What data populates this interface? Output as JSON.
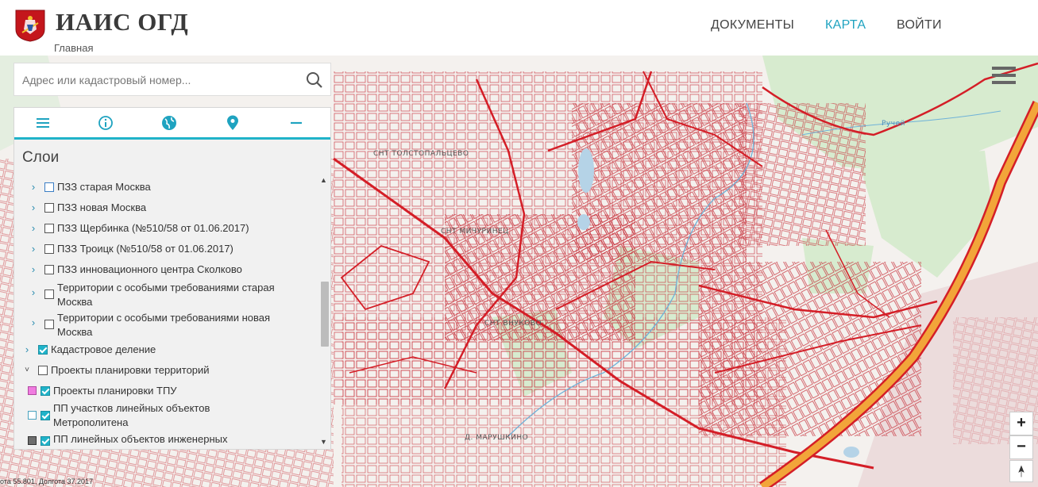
{
  "header": {
    "app_title": "ИАИС ОГД",
    "breadcrumb": "Главная",
    "nav": [
      {
        "label": "ДОКУМЕНТЫ",
        "active": false
      },
      {
        "label": "КАРТА",
        "active": true
      },
      {
        "label": "ВОЙТИ",
        "active": false
      }
    ]
  },
  "search": {
    "placeholder": "Адрес или кадастровый номер...",
    "value": "",
    "icon": "search-icon"
  },
  "panel": {
    "title": "Слои",
    "tools": [
      "menu-icon",
      "info-icon",
      "globe-icon",
      "location-pin-icon",
      "minus-icon"
    ],
    "layers": [
      {
        "label": "ПЗЗ старая Москва",
        "expandable": true,
        "expanded": false,
        "checked": false,
        "level": 2
      },
      {
        "label": "ПЗЗ новая Москва",
        "expandable": true,
        "expanded": false,
        "checked": false,
        "level": 2
      },
      {
        "label": "ПЗЗ Щербинка (№510/58 от 01.06.2017)",
        "expandable": true,
        "expanded": false,
        "checked": false,
        "level": 2
      },
      {
        "label": "ПЗЗ Троицк (№510/58 от 01.06.2017)",
        "expandable": true,
        "expanded": false,
        "checked": false,
        "level": 2
      },
      {
        "label": "ПЗЗ инновационного центра Сколково",
        "expandable": true,
        "expanded": false,
        "checked": false,
        "level": 2
      },
      {
        "label1": "Территории с особыми требованиями старая",
        "label2": "Москва",
        "expandable": true,
        "expanded": false,
        "checked": false,
        "level": 2
      },
      {
        "label1": "Территории с особыми требованиями новая",
        "label2": "Москва",
        "expandable": true,
        "expanded": false,
        "checked": false,
        "level": 2
      },
      {
        "label": "Кадастровое деление",
        "expandable": true,
        "expanded": false,
        "checked": true,
        "level": 1
      },
      {
        "label": "Проекты планировки территорий",
        "expandable": true,
        "expanded": true,
        "checked": false,
        "level": 1
      },
      {
        "label": "Проекты планировки ТПУ",
        "swatch": "#f07ce0",
        "checked": true,
        "level": 0
      },
      {
        "label1": "ПП участков линейных объектов",
        "label2": "Метрополитена",
        "swatch": "#ffffff",
        "checked": true,
        "level": 0
      },
      {
        "label": "ПП линейных объектов инженерных",
        "swatch": "#6d6d6d",
        "checked": true,
        "level": 0
      }
    ]
  },
  "map": {
    "labels": [
      "СНТ ТОЛСТОПАЛЬЦЕВО",
      "СНТ МИЧУРИНЕЦ",
      "СНТ ВНУКОВО",
      "Д. МАРУШКИНО",
      "Ручей"
    ],
    "scale_text": "ота 55.801, Долгота 37.2017",
    "colors": {
      "parcel": "#c8323c",
      "road": "#d41e27",
      "highway": "#f2a53a",
      "water": "#b5d3e7",
      "park": "#cfe8c9"
    }
  },
  "controls": {
    "zoom_in": "+",
    "zoom_out": "−",
    "north": "north-arrow-icon"
  }
}
